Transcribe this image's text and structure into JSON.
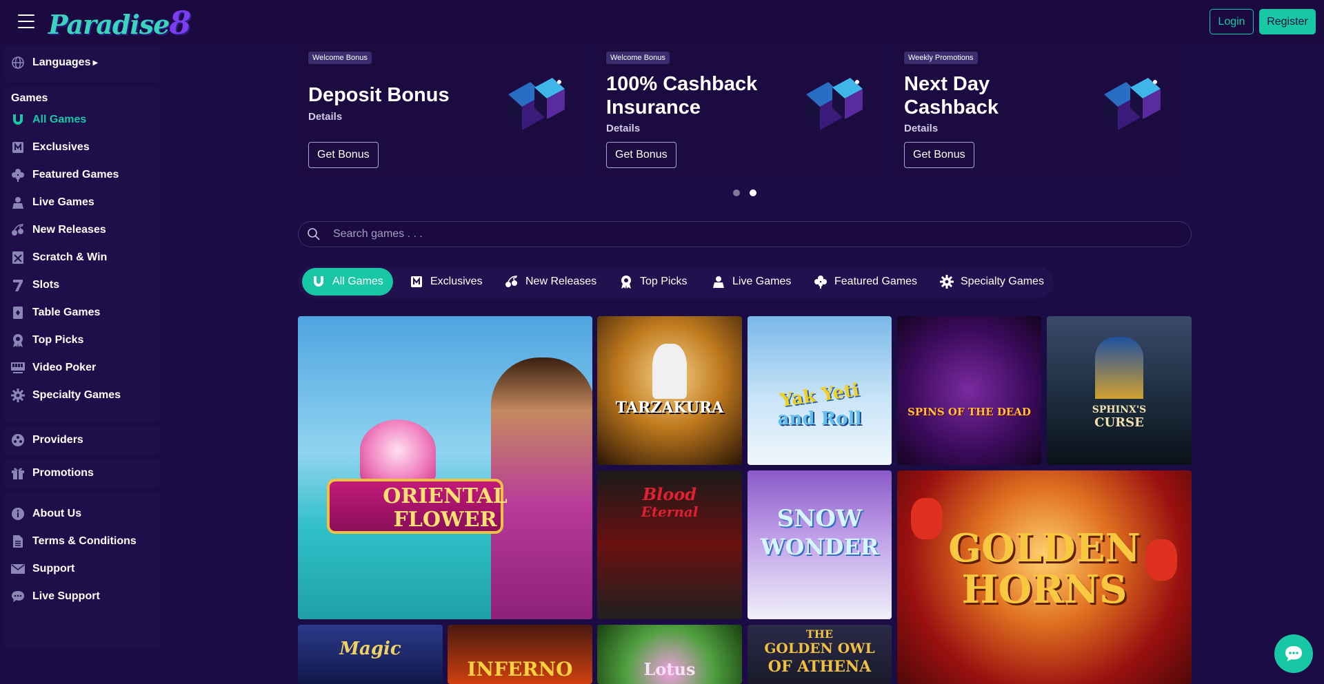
{
  "header": {
    "logo_text": "Paradise",
    "logo_eight": "8",
    "login_label": "Login",
    "register_label": "Register"
  },
  "sidebar": {
    "languages_label": "Languages",
    "games_heading": "Games",
    "game_items": [
      {
        "label": "All Games",
        "icon": "horseshoe-icon"
      },
      {
        "label": "Exclusives",
        "icon": "exclusive-badge-icon"
      },
      {
        "label": "Featured Games",
        "icon": "clover-icon"
      },
      {
        "label": "Live Games",
        "icon": "dealer-icon"
      },
      {
        "label": "New Releases",
        "icon": "cherries-icon"
      },
      {
        "label": "Scratch & Win",
        "icon": "scratch-card-icon"
      },
      {
        "label": "Slots",
        "icon": "seven-icon"
      },
      {
        "label": "Table Games",
        "icon": "playing-card-icon"
      },
      {
        "label": "Top Picks",
        "icon": "award-ribbon-icon"
      },
      {
        "label": "Video Poker",
        "icon": "video-poker-icon"
      },
      {
        "label": "Specialty Games",
        "icon": "gear-icon"
      }
    ],
    "providers_label": "Providers",
    "promotions_label": "Promotions",
    "info_items": [
      {
        "label": "About Us",
        "icon": "info-icon"
      },
      {
        "label": "Terms & Conditions",
        "icon": "document-icon"
      },
      {
        "label": "Support",
        "icon": "envelope-icon"
      },
      {
        "label": "Live Support",
        "icon": "chat-bubble-icon"
      }
    ]
  },
  "promos": [
    {
      "badge": "Welcome Bonus",
      "title": "Deposit Bonus",
      "details": "Details",
      "button": "Get Bonus"
    },
    {
      "badge": "Welcome Bonus",
      "title": "100% Cashback Insurance",
      "details": "Details",
      "button": "Get Bonus"
    },
    {
      "badge": "Weekly Promotions",
      "title": "Next Day Cashback",
      "details": "Details",
      "button": "Get Bonus"
    }
  ],
  "carousel": {
    "pages": 2,
    "active_page": 2
  },
  "search": {
    "placeholder": "Search games . . ."
  },
  "tabs": [
    {
      "label": "All Games",
      "icon": "horseshoe-icon",
      "active": true
    },
    {
      "label": "Exclusives",
      "icon": "exclusive-badge-icon",
      "active": false
    },
    {
      "label": "New Releases",
      "icon": "cherries-icon",
      "active": false
    },
    {
      "label": "Top Picks",
      "icon": "award-ribbon-icon",
      "active": false
    },
    {
      "label": "Live Games",
      "icon": "dealer-icon",
      "active": false
    },
    {
      "label": "Featured Games",
      "icon": "clover-icon",
      "active": false
    },
    {
      "label": "Specialty Games",
      "icon": "gear-icon",
      "active": false
    }
  ],
  "games": [
    {
      "title_line1": "ORIENTAL",
      "title_line2": "FLOWER"
    },
    {
      "title_line1": "TARZAKURA"
    },
    {
      "title_line1": "Yak Yeti",
      "title_line2": "and Roll"
    },
    {
      "title_line1": "SPINS OF THE DEAD"
    },
    {
      "title_line1": "SPHINX'S",
      "title_line2": "CURSE"
    },
    {
      "title_line1": "Blood",
      "title_line2": "Eternal"
    },
    {
      "title_line1": "SNOW",
      "title_line2": "WONDER"
    },
    {
      "title_line1": "GOLDEN",
      "title_line2": "HORNS"
    },
    {
      "title_line1": "Magic"
    },
    {
      "title_line1": "INFERNO"
    },
    {
      "title_line1": "Lotus"
    },
    {
      "title_line1": "THE",
      "title_line2": "GOLDEN OWL",
      "title_line3": "OF ATHENA"
    }
  ],
  "colors": {
    "accent": "#18c8a4",
    "background": "#1c0c45",
    "topbar": "#1b0a3f"
  }
}
